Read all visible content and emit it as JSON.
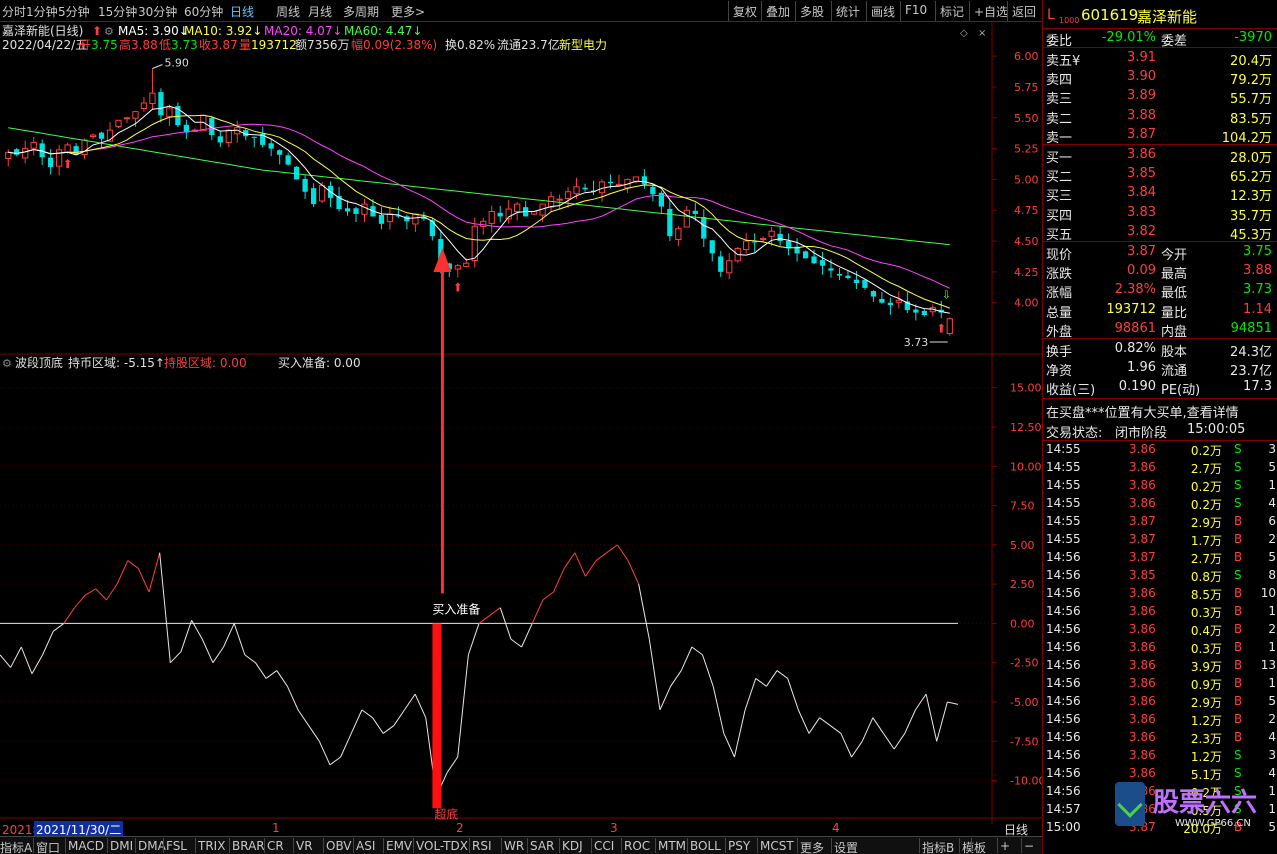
{
  "toolbar": {
    "left": [
      "分时",
      "1分钟",
      "5分钟",
      "15分钟",
      "30分钟",
      "60分钟",
      "日线",
      "周线",
      "月线",
      "多周期",
      "更多>"
    ],
    "active": "日线",
    "right": [
      "复权",
      "叠加",
      "多股",
      "统计",
      "画线",
      "F10",
      "标记",
      "+自选",
      "返回"
    ]
  },
  "main_chart": {
    "title": "嘉泽新能(日线)",
    "ma_legend": [
      {
        "label": "MA5: 3.90",
        "arrow": "↓",
        "color": "#ffffff"
      },
      {
        "label": "MA10: 3.92",
        "arrow": "↓",
        "color": "#ffff40"
      },
      {
        "label": "MA20: 4.07",
        "arrow": "↓",
        "color": "#ff40ff"
      },
      {
        "label": "MA60: 4.47",
        "arrow": "↓",
        "color": "#40ff40"
      }
    ],
    "info_line": {
      "date": "2022/04/22/五",
      "open_label": "开",
      "open": "3.75",
      "high_label": "高",
      "high": "3.88",
      "low_label": "低",
      "low": "3.73",
      "close_label": "收",
      "close": "3.87",
      "vol_label": "量",
      "vol": "193712",
      "amount_label": "额",
      "amount": "7356万",
      "range_label": "幅",
      "range": "0.09(2.38%)",
      "turnover": "换0.82%",
      "float": "流通23.7亿",
      "concept": "新型电力"
    },
    "max_label": "5.90",
    "min_label": "3.73",
    "y_ticks": [
      "6.00",
      "5.75",
      "5.50",
      "5.25",
      "5.00",
      "4.75",
      "4.50",
      "4.25",
      "4.00"
    ]
  },
  "sub_chart": {
    "name": "波段顶底",
    "legend": [
      {
        "label": "持币区域: -5.15",
        "arrow": "↑",
        "color": "#e0e0e0"
      },
      {
        "label": "持股区域: 0.00",
        "arrow": "",
        "color": "#ff3c3c"
      },
      {
        "label": "买入准备: 0.00",
        "arrow": "",
        "color": "#e0e0e0"
      }
    ],
    "annotation_buy": "买入准备",
    "annotation_bottom": "超底",
    "y_ticks": [
      "15.00",
      "12.50",
      "10.00",
      "7.50",
      "5.00",
      "2.50",
      "0.00",
      "-2.50",
      "-5.00",
      "-7.50",
      "-10.00"
    ]
  },
  "chart_data": [
    {
      "type": "candlestick",
      "title": "嘉泽新能(日线)",
      "ylim": [
        3.6,
        6.05
      ],
      "close": [
        5.22,
        5.2,
        5.25,
        5.3,
        5.18,
        5.1,
        5.24,
        5.28,
        5.2,
        5.32,
        5.36,
        5.33,
        5.4,
        5.48,
        5.5,
        5.55,
        5.62,
        5.7,
        5.52,
        5.58,
        5.44,
        5.38,
        5.4,
        5.52,
        5.36,
        5.3,
        5.4,
        5.42,
        5.35,
        5.34,
        5.28,
        5.25,
        5.2,
        5.12,
        5.0,
        4.9,
        4.8,
        4.95,
        4.85,
        4.76,
        4.74,
        4.72,
        4.8,
        4.7,
        4.64,
        4.72,
        4.7,
        4.66,
        4.72,
        4.68,
        4.54,
        4.3,
        4.27,
        4.3,
        4.32,
        4.62,
        4.66,
        4.74,
        4.7,
        4.76,
        4.8,
        4.7,
        4.74,
        4.8,
        4.86,
        4.84,
        4.9,
        4.94,
        4.92,
        4.9,
        4.98,
        4.97,
        4.96,
        5.0,
        5.02,
        4.96,
        4.88,
        4.78,
        4.54,
        4.6,
        4.75,
        4.72,
        4.52,
        4.4,
        4.25,
        4.34,
        4.44,
        4.5,
        4.49,
        4.52,
        4.58,
        4.5,
        4.44,
        4.4,
        4.36,
        4.32,
        4.3,
        4.26,
        4.22,
        4.2,
        4.16,
        4.12,
        4.05,
        4.0,
        3.98,
        4.02,
        3.94,
        3.92,
        3.9,
        3.96,
        3.92,
        3.87
      ],
      "ma5_last": 3.9,
      "ma10_last": 3.92,
      "ma20_last": 4.07,
      "ma60_last": 4.47
    },
    {
      "type": "line",
      "name": "波段顶底",
      "ylim": [
        -12,
        16
      ],
      "values": [
        -2.0,
        -2.8,
        -1.5,
        -3.2,
        -2.0,
        -0.5,
        0.0,
        1.0,
        1.8,
        2.2,
        1.5,
        2.5,
        4.0,
        3.5,
        2.0,
        4.5,
        -2.5,
        -1.8,
        0.2,
        -1.0,
        -2.5,
        -1.5,
        0.0,
        -2.0,
        -2.5,
        -3.5,
        -3.0,
        -4.0,
        -5.5,
        -6.5,
        -7.5,
        -9.0,
        -8.5,
        -7.0,
        -5.5,
        -6.0,
        -7.0,
        -6.5,
        -5.5,
        -4.5,
        -6.0,
        -11.0,
        -9.5,
        -8.5,
        -2.0,
        0.0,
        0.5,
        1.0,
        -1.0,
        -1.5,
        0.0,
        1.5,
        2.0,
        3.5,
        4.5,
        3.0,
        4.0,
        4.5,
        5.0,
        4.0,
        2.5,
        -1.0,
        -5.5,
        -4.0,
        -3.0,
        -1.5,
        -2.0,
        -4.0,
        -7.0,
        -8.5,
        -5.5,
        -3.5,
        -4.0,
        -3.0,
        -3.5,
        -5.5,
        -7.0,
        -6.0,
        -6.5,
        -7.0,
        -8.5,
        -7.5,
        -6.0,
        -7.0,
        -8.0,
        -7.0,
        -5.5,
        -4.5,
        -7.5,
        -5.0,
        -5.15
      ],
      "zero_line": 0
    }
  ],
  "date_axis": {
    "labels": [
      "2021年",
      "2021/11/30/二",
      "1",
      "2",
      "3",
      "4"
    ],
    "period": "日线"
  },
  "bottom_tabs": [
    "指标A",
    "窗口",
    "MACD",
    "DMI",
    "DMA",
    "FSL",
    "TRIX",
    "BRAR",
    "CR",
    "VR",
    "OBV",
    "ASI",
    "EMV",
    "VOL-TDX",
    "RSI",
    "WR",
    "SAR",
    "KDJ",
    "CCI",
    "ROC",
    "MTM",
    "BOLL",
    "PSY",
    "MCST",
    "更多",
    "设置",
    "指标B",
    "模",
    "板",
    "+",
    "−"
  ],
  "quote": {
    "prefix": "L",
    "market": "1000",
    "code": "601619",
    "name": "嘉泽新能",
    "weibi_label": "委比",
    "weibi": "-29.01%",
    "weicha_label": "委差",
    "weicha": "-3970",
    "sell": [
      {
        "label": "卖五",
        "price": "3.91",
        "vol": "20.4万",
        "mark": "¥"
      },
      {
        "label": "卖四",
        "price": "3.90",
        "vol": "79.2万"
      },
      {
        "label": "卖三",
        "price": "3.89",
        "vol": "55.7万"
      },
      {
        "label": "卖二",
        "price": "3.88",
        "vol": "83.5万"
      },
      {
        "label": "卖一",
        "price": "3.87",
        "vol": "104.2万"
      }
    ],
    "buy": [
      {
        "label": "买一",
        "price": "3.86",
        "vol": "28.0万"
      },
      {
        "label": "买二",
        "price": "3.85",
        "vol": "65.2万"
      },
      {
        "label": "买三",
        "price": "3.84",
        "vol": "12.3万"
      },
      {
        "label": "买四",
        "price": "3.83",
        "vol": "35.7万"
      },
      {
        "label": "买五",
        "price": "3.82",
        "vol": "45.3万"
      }
    ],
    "stats": [
      {
        "l1": "现价",
        "v1": "3.87",
        "c1": "red",
        "l2": "今开",
        "v2": "3.75",
        "c2": "grn"
      },
      {
        "l1": "涨跌",
        "v1": "0.09",
        "c1": "red",
        "l2": "最高",
        "v2": "3.88",
        "c2": "red"
      },
      {
        "l1": "涨幅",
        "v1": "2.38%",
        "c1": "red",
        "l2": "最低",
        "v2": "3.73",
        "c2": "grn"
      },
      {
        "l1": "总量",
        "v1": "193712",
        "c1": "yel",
        "l2": "量比",
        "v2": "1.14",
        "c2": "red"
      },
      {
        "l1": "外盘",
        "v1": "98861",
        "c1": "red",
        "l2": "内盘",
        "v2": "94851",
        "c2": "grn"
      }
    ],
    "stats2": [
      {
        "l1": "换手",
        "v1": "0.82%",
        "l2": "股本",
        "v2": "24.3亿"
      },
      {
        "l1": "净资",
        "v1": "1.96",
        "l2": "流通",
        "v2": "23.7亿"
      },
      {
        "l1": "收益(三)",
        "v1": "0.190",
        "l2": "PE(动)",
        "v2": "17.3"
      }
    ],
    "notice": "在买盘***位置有大买单,查看详情",
    "status_label": "交易状态:",
    "status": "闭市阶段",
    "status_time": "15:00:05",
    "ticks": [
      {
        "t": "14:55",
        "p": "3.86",
        "v": "0.2万",
        "s": "S",
        "n": "3"
      },
      {
        "t": "14:55",
        "p": "3.86",
        "v": "2.7万",
        "s": "S",
        "n": "5"
      },
      {
        "t": "14:55",
        "p": "3.86",
        "v": "0.2万",
        "s": "S",
        "n": "1"
      },
      {
        "t": "14:55",
        "p": "3.86",
        "v": "0.2万",
        "s": "S",
        "n": "4"
      },
      {
        "t": "14:55",
        "p": "3.87",
        "v": "2.9万",
        "s": "B",
        "n": "6"
      },
      {
        "t": "14:55",
        "p": "3.87",
        "v": "1.7万",
        "s": "B",
        "n": "2"
      },
      {
        "t": "14:56",
        "p": "3.87",
        "v": "2.7万",
        "s": "B",
        "n": "5"
      },
      {
        "t": "14:56",
        "p": "3.85",
        "v": "0.8万",
        "s": "S",
        "n": "8"
      },
      {
        "t": "14:56",
        "p": "3.86",
        "v": "8.5万",
        "s": "B",
        "n": "10"
      },
      {
        "t": "14:56",
        "p": "3.86",
        "v": "0.3万",
        "s": "B",
        "n": "1"
      },
      {
        "t": "14:56",
        "p": "3.86",
        "v": "0.4万",
        "s": "B",
        "n": "2"
      },
      {
        "t": "14:56",
        "p": "3.86",
        "v": "0.3万",
        "s": "B",
        "n": "1"
      },
      {
        "t": "14:56",
        "p": "3.86",
        "v": "3.9万",
        "s": "B",
        "n": "13"
      },
      {
        "t": "14:56",
        "p": "3.86",
        "v": "0.9万",
        "s": "B",
        "n": "1"
      },
      {
        "t": "14:56",
        "p": "3.86",
        "v": "2.9万",
        "s": "B",
        "n": "5"
      },
      {
        "t": "14:56",
        "p": "3.86",
        "v": "1.2万",
        "s": "B",
        "n": "2"
      },
      {
        "t": "14:56",
        "p": "3.86",
        "v": "2.3万",
        "s": "B",
        "n": "4"
      },
      {
        "t": "14:56",
        "p": "3.86",
        "v": "1.2万",
        "s": "S",
        "n": "3"
      },
      {
        "t": "14:56",
        "p": "3.86",
        "v": "5.1万",
        "s": "S",
        "n": "4"
      },
      {
        "t": "14:56",
        "p": "3.86",
        "v": "0.2万",
        "s": "S",
        "n": "1"
      },
      {
        "t": "14:57",
        "p": "3.86",
        "v": "0.5万",
        "s": "S",
        "n": "1"
      },
      {
        "t": "15:00",
        "p": "3.87",
        "v": "20.0万",
        "s": "B",
        "n": "5"
      }
    ]
  },
  "watermark": "股票六六",
  "watermark_url": "WWW.GP66.CN",
  "colors": {
    "up": "#ff3c3c",
    "down": "#00e0e0",
    "ma5": "#ffffff",
    "ma10": "#ffff40",
    "ma20": "#ff40ff",
    "ma60": "#40ff40",
    "border": "#800000"
  }
}
